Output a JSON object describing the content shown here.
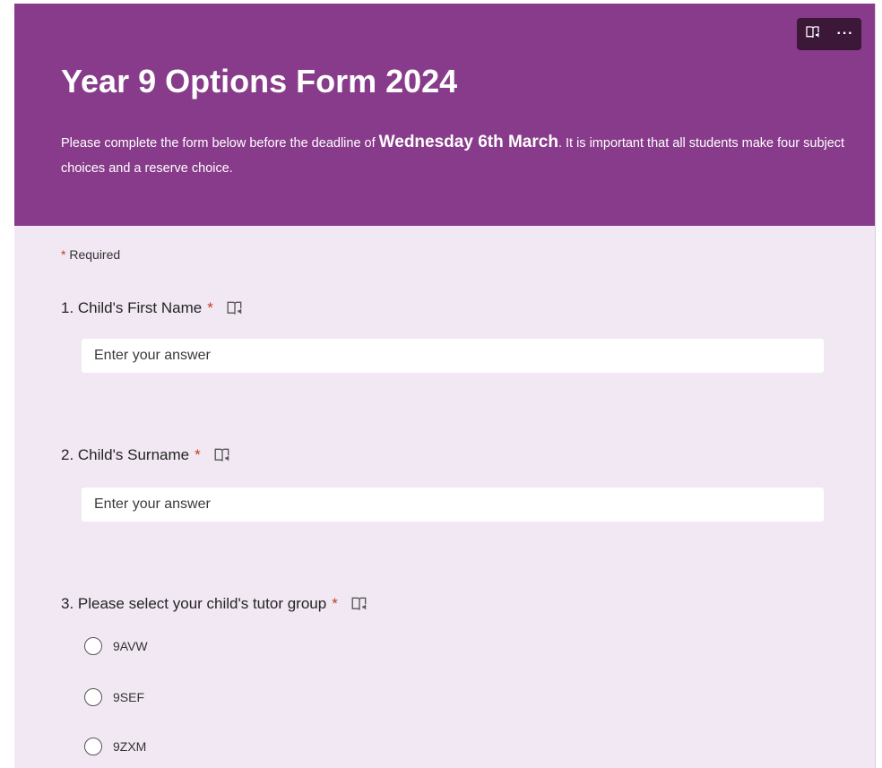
{
  "header": {
    "title": "Year 9 Options Form 2024",
    "description_part1": "Please complete the form below before the deadline of ",
    "description_deadline": "Wednesday 6th March",
    "description_part2": ". It is important that all students make four subject choices and a reserve choice.",
    "accent_color": "#883b8a"
  },
  "toolbar": {
    "reader_icon": "immersive-reader-icon",
    "more_label": "···"
  },
  "required_note": {
    "star": "*",
    "label": "Required"
  },
  "questions": [
    {
      "label": "1. Child's First Name",
      "star": "*",
      "placeholder": "Enter your answer",
      "icon": "immersive-reader-icon"
    },
    {
      "label": "2. Child's Surname",
      "star": "*",
      "placeholder": "Enter your answer",
      "icon": "immersive-reader-icon"
    },
    {
      "label": "3. Please select your child's tutor group",
      "star": "*",
      "icon": "immersive-reader-icon",
      "options": [
        "9AVW",
        "9SEF",
        "9ZXM"
      ]
    }
  ]
}
